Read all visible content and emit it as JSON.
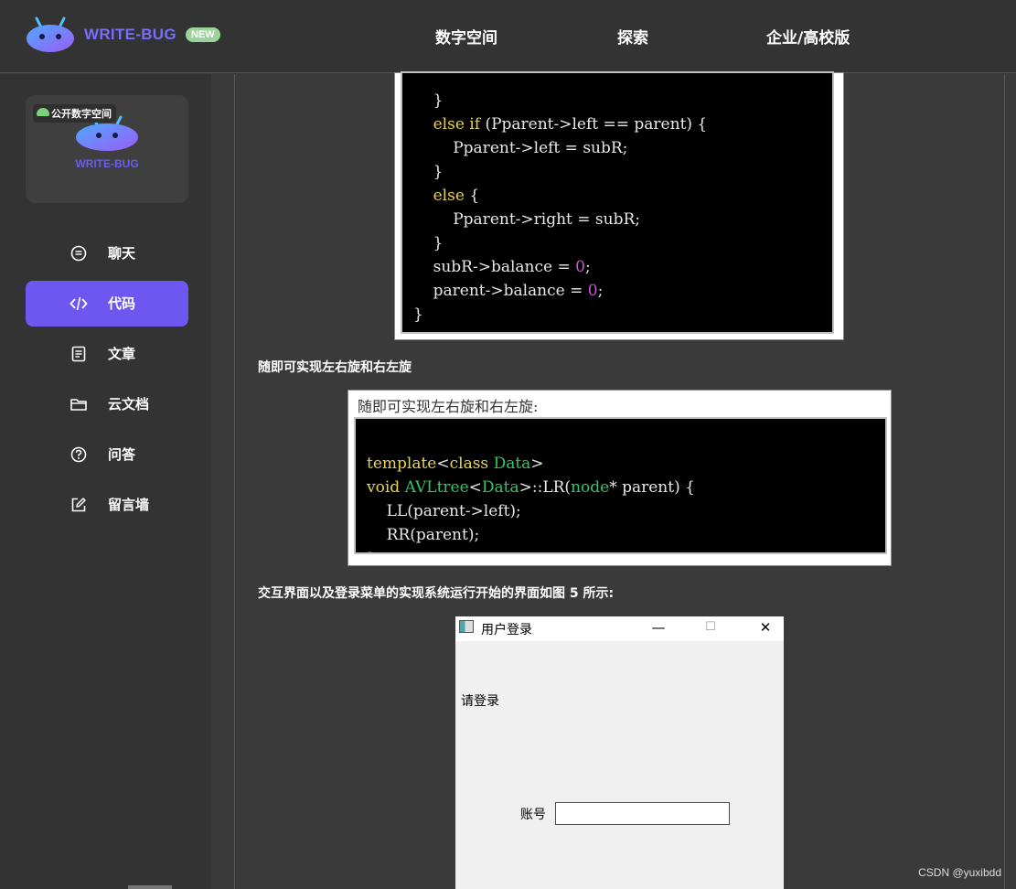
{
  "header": {
    "brand": "WRITE-BUG",
    "badge": "NEW",
    "nav": [
      "数字空间",
      "探索",
      "企业/高校版"
    ]
  },
  "sidebar": {
    "card": {
      "tag": "公开数字空间",
      "name": "WRITE-BUG"
    },
    "items": [
      {
        "label": "聊天",
        "icon": "chat-icon"
      },
      {
        "label": "代码",
        "icon": "code-icon",
        "active": true
      },
      {
        "label": "文章",
        "icon": "article-icon"
      },
      {
        "label": "云文档",
        "icon": "folder-icon"
      },
      {
        "label": "问答",
        "icon": "question-icon"
      },
      {
        "label": "留言墙",
        "icon": "edit-icon"
      }
    ]
  },
  "content": {
    "code1_lines": [
      "    }",
      "    else if (Pparent->left == parent) {",
      "        Pparent->left = subR;",
      "    }",
      "    else {",
      "        Pparent->right = subR;",
      "    }",
      "    subR->balance = 0;",
      "    parent->balance = 0;",
      "}"
    ],
    "para1": "随即可实现左右旋和右左旋",
    "code2_caption": "随即可实现左右旋和右左旋:",
    "code2_lines": [
      "template<class Data>",
      "void AVLtree<Data>::LR(node* parent) {",
      "    LL(parent->left);",
      "    RR(parent);",
      "}"
    ],
    "para2": "交互界面以及登录菜单的实现系统运行开始的界面如图 5 所示:",
    "login": {
      "title": "用户登录",
      "min": "—",
      "max": "☐",
      "close": "✕",
      "prompt": "请登录",
      "account_label": "账号",
      "account_value": ""
    }
  },
  "watermark": "CSDN @yuxibdd",
  "colors": {
    "accent": "#6e57f0",
    "brand": "#7a6cff",
    "badge": "#9bd49a"
  }
}
